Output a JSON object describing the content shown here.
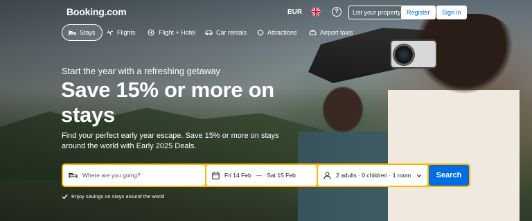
{
  "header": {
    "logo": "Booking.com",
    "currency": "EUR",
    "help_symbol": "?",
    "list_property": "List your property",
    "register": "Register",
    "sign_in": "Sign in",
    "flag_icon": "uk-flag-icon"
  },
  "nav": {
    "tabs": [
      {
        "label": "Stays",
        "icon": "bed-icon",
        "active": true
      },
      {
        "label": "Flights",
        "icon": "plane-icon",
        "active": false
      },
      {
        "label": "Flight + Hotel",
        "icon": "flight-hotel-icon",
        "active": false
      },
      {
        "label": "Car rentals",
        "icon": "car-icon",
        "active": false
      },
      {
        "label": "Attractions",
        "icon": "attractions-icon",
        "active": false
      },
      {
        "label": "Airport taxis",
        "icon": "taxi-icon",
        "active": false
      }
    ]
  },
  "hero": {
    "kicker": "Start the year with a refreshing getaway",
    "headline": "Save 15% or more on stays",
    "subtext": "Find your perfect early year escape. Save 15% or more on stays around the world with Early 2025 Deals."
  },
  "search": {
    "destination_placeholder": "Where are you going?",
    "check_in": "Fri 14 Feb",
    "dates_separator": "—",
    "check_out": "Sat 15 Feb",
    "guests": "2 adults · 0 children · 1 room",
    "button": "Search"
  },
  "savings_note": "Enjoy savings on stays around the world",
  "colors": {
    "accent_blue": "#006ce4",
    "search_border": "#ffb700"
  }
}
